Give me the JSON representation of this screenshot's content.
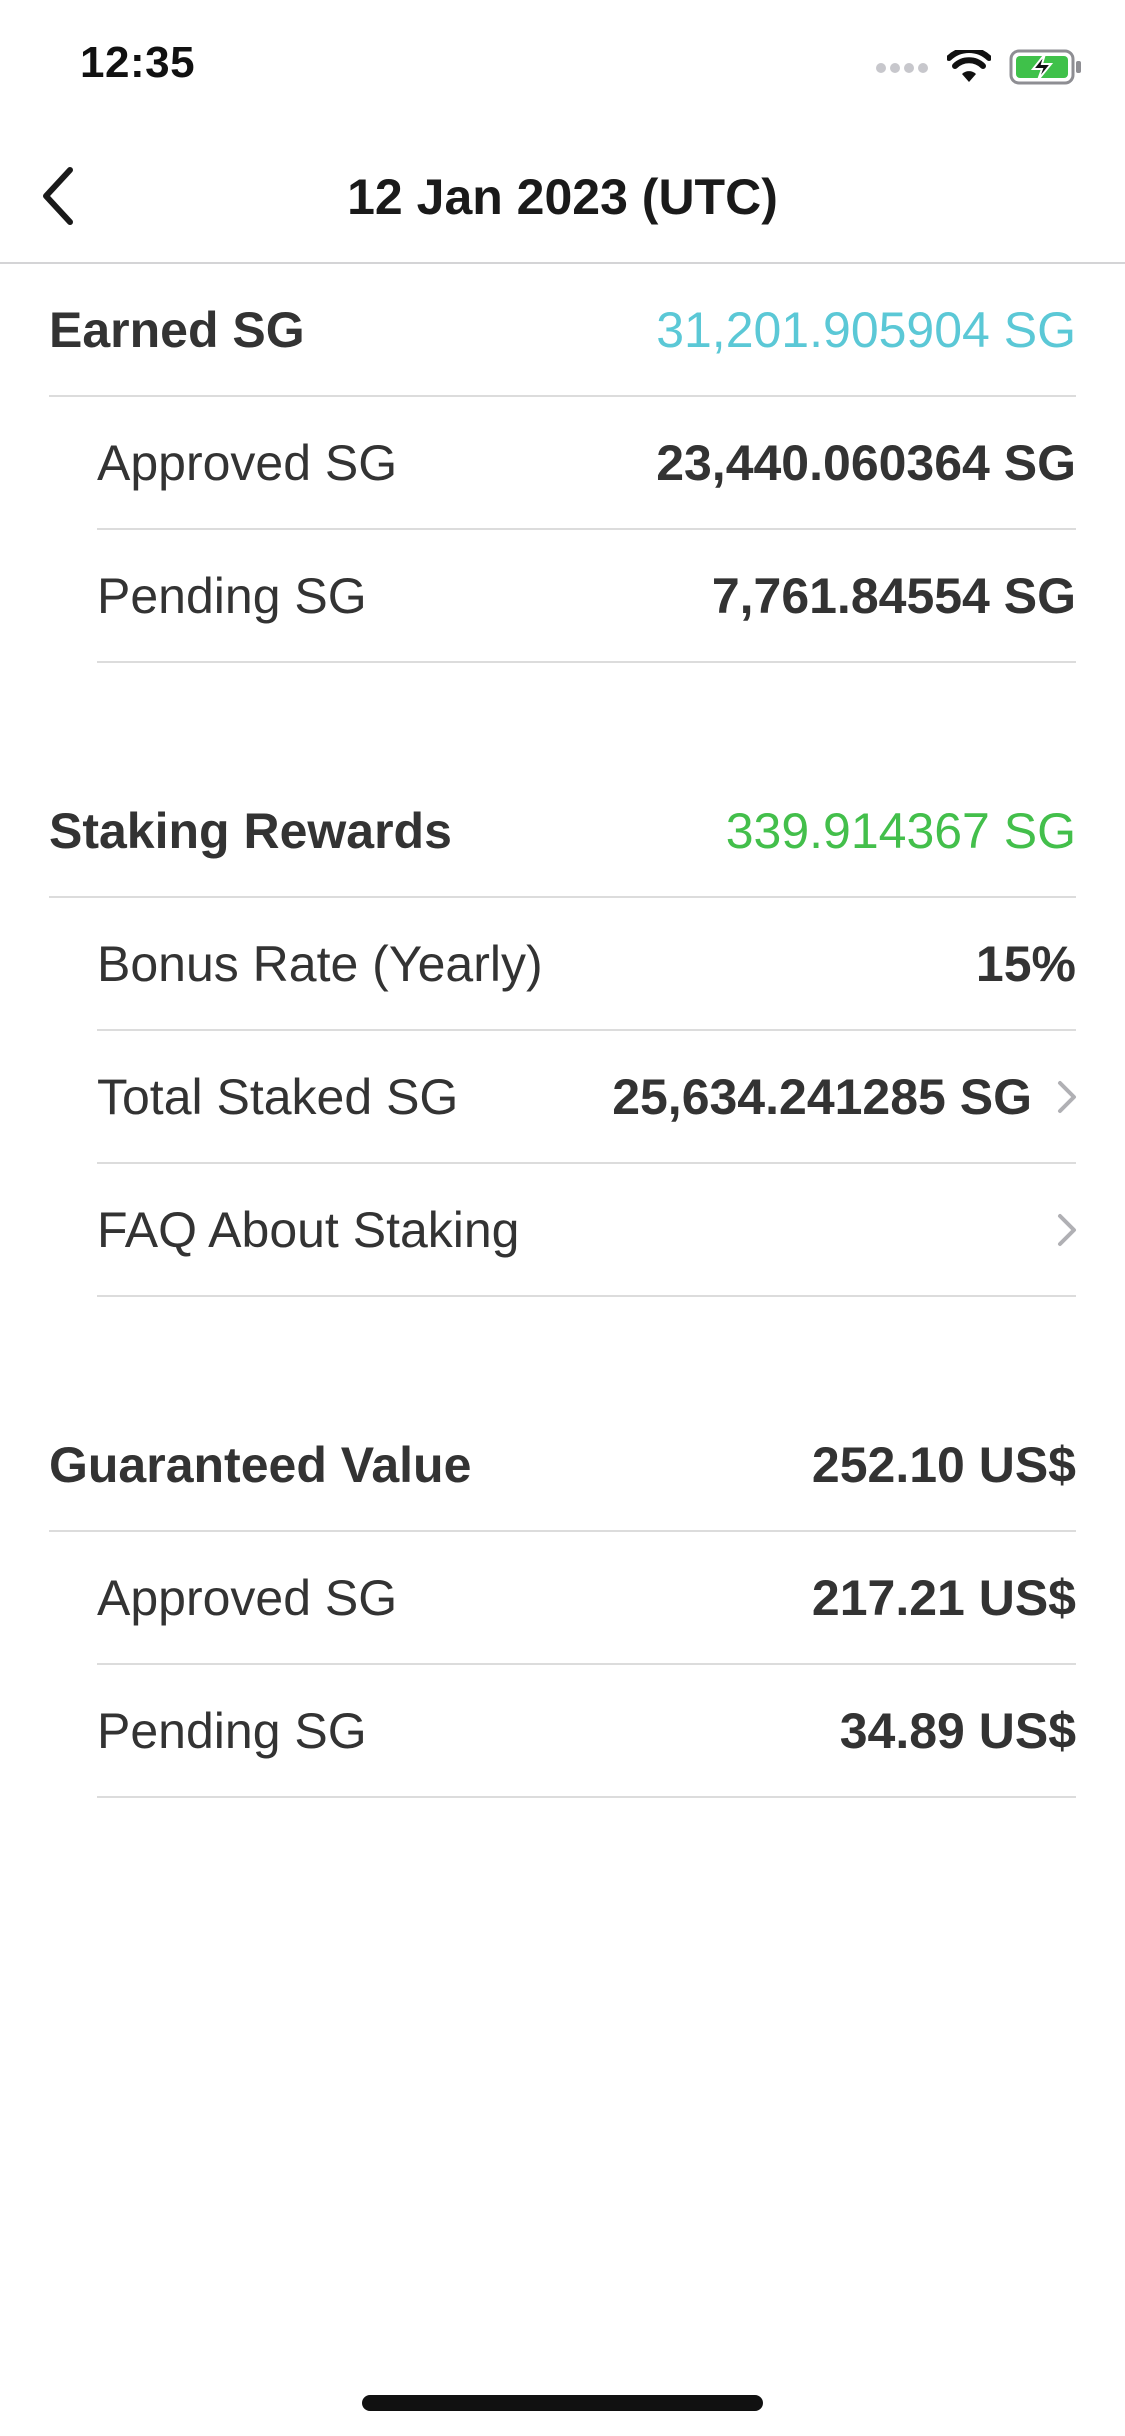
{
  "status_bar": {
    "time": "12:35"
  },
  "nav": {
    "title": "12 Jan 2023 (UTC)"
  },
  "colors": {
    "earned_value": "#5bc8d6",
    "staking_value": "#43bf4b",
    "text_primary": "#333333",
    "separator": "#dcdcdc",
    "battery_charge": "#3fc14a"
  },
  "icons": {
    "back": "chevron-left-icon",
    "disclosure": "chevron-right-icon",
    "signal": "cellular-signal-icon",
    "wifi": "wifi-icon",
    "battery": "battery-charging-icon"
  },
  "sections": {
    "earned": {
      "label": "Earned SG",
      "value": "31,201.905904 SG",
      "approved_label": "Approved SG",
      "approved_value": "23,440.060364 SG",
      "pending_label": "Pending SG",
      "pending_value": "7,761.84554 SG"
    },
    "staking": {
      "label": "Staking Rewards",
      "value": "339.914367 SG",
      "bonus_label": "Bonus Rate (Yearly)",
      "bonus_value": "15%",
      "total_label": "Total Staked SG",
      "total_value": "25,634.241285 SG",
      "faq_label": "FAQ About Staking"
    },
    "guaranteed": {
      "label": "Guaranteed Value",
      "value": "252.10 US$",
      "approved_label": "Approved SG",
      "approved_value": "217.21 US$",
      "pending_label": "Pending SG",
      "pending_value": "34.89 US$"
    }
  }
}
